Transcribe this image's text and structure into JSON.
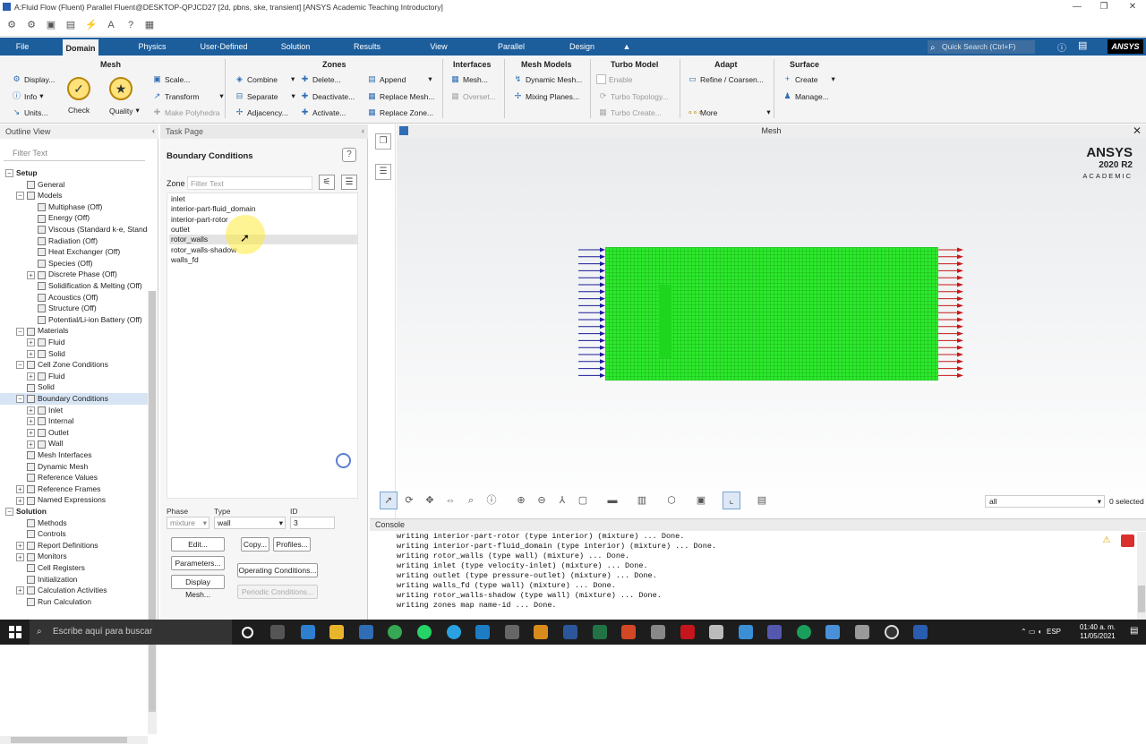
{
  "window": {
    "title": "A:Fluid Flow (Fluent) Parallel Fluent@DESKTOP-QPJCD27  [2d, pbns, ske, transient] [ANSYS Academic Teaching Introductory]",
    "controls": [
      "—",
      "❐",
      "✕"
    ]
  },
  "menu": {
    "tabs": [
      "File",
      "Domain",
      "Physics",
      "User-Defined",
      "Solution",
      "Results",
      "View",
      "Parallel",
      "Design"
    ],
    "active": "Domain",
    "search_placeholder": "Quick Search (Ctrl+F)",
    "logo": "ANSYS"
  },
  "ribbon": {
    "mesh": {
      "title": "Mesh",
      "display": "Display...",
      "info": "Info",
      "units": "Units...",
      "check": "Check",
      "quality": "Quality"
    },
    "scale": "Scale...",
    "transform": "Transform",
    "make_polyhedra": "Make Polyhedra",
    "zones": {
      "title": "Zones",
      "combine": "Combine",
      "separate": "Separate",
      "adjacency": "Adjacency...",
      "delete": "Delete...",
      "deactivate": "Deactivate...",
      "activate": "Activate...",
      "append": "Append",
      "replace_mesh": "Replace Mesh...",
      "replace_zone": "Replace Zone..."
    },
    "interfaces": {
      "title": "Interfaces",
      "mesh": "Mesh...",
      "overset": "Overset..."
    },
    "mesh_models": {
      "title": "Mesh Models",
      "dynamic_mesh": "Dynamic Mesh...",
      "mixing_planes": "Mixing Planes..."
    },
    "turbo": {
      "title": "Turbo Model",
      "enable": "Enable",
      "topology": "Turbo Topology...",
      "create": "Turbo Create..."
    },
    "adapt": {
      "title": "Adapt",
      "refine": "Refine / Coarsen...",
      "more": "More"
    },
    "surface": {
      "title": "Surface",
      "create": "Create",
      "manage": "Manage..."
    }
  },
  "outline": {
    "title": "Outline View",
    "filter_placeholder": "Filter Text",
    "items": [
      {
        "label": "Setup",
        "level": 0,
        "bold": true,
        "toggle": "−"
      },
      {
        "label": "General",
        "level": 2
      },
      {
        "label": "Models",
        "level": 1,
        "toggle": "−"
      },
      {
        "label": "Multiphase (Off)",
        "level": 3
      },
      {
        "label": "Energy (Off)",
        "level": 3
      },
      {
        "label": "Viscous (Standard k-e, Standard Wall Fn)",
        "level": 3
      },
      {
        "label": "Radiation (Off)",
        "level": 3
      },
      {
        "label": "Heat Exchanger (Off)",
        "level": 3
      },
      {
        "label": "Species (Off)",
        "level": 3
      },
      {
        "label": "Discrete Phase (Off)",
        "level": 2,
        "toggle": "+"
      },
      {
        "label": "Solidification & Melting (Off)",
        "level": 3
      },
      {
        "label": "Acoustics (Off)",
        "level": 3
      },
      {
        "label": "Structure (Off)",
        "level": 3
      },
      {
        "label": "Potential/Li-ion Battery (Off)",
        "level": 3
      },
      {
        "label": "Materials",
        "level": 1,
        "toggle": "−"
      },
      {
        "label": "Fluid",
        "level": 2,
        "toggle": "+"
      },
      {
        "label": "Solid",
        "level": 2,
        "toggle": "+"
      },
      {
        "label": "Cell Zone Conditions",
        "level": 1,
        "toggle": "−"
      },
      {
        "label": "Fluid",
        "level": 2,
        "toggle": "+"
      },
      {
        "label": "Solid",
        "level": 2
      },
      {
        "label": "Boundary Conditions",
        "level": 1,
        "toggle": "−",
        "selected": true
      },
      {
        "label": "Inlet",
        "level": 2,
        "toggle": "+"
      },
      {
        "label": "Internal",
        "level": 2,
        "toggle": "+"
      },
      {
        "label": "Outlet",
        "level": 2,
        "toggle": "+"
      },
      {
        "label": "Wall",
        "level": 2,
        "toggle": "+"
      },
      {
        "label": "Mesh Interfaces",
        "level": 2
      },
      {
        "label": "Dynamic Mesh",
        "level": 2
      },
      {
        "label": "Reference Values",
        "level": 2
      },
      {
        "label": "Reference Frames",
        "level": 1,
        "toggle": "+"
      },
      {
        "label": "Named Expressions",
        "level": 1,
        "toggle": "+"
      },
      {
        "label": "Solution",
        "level": 0,
        "bold": true,
        "toggle": "−"
      },
      {
        "label": "Methods",
        "level": 2
      },
      {
        "label": "Controls",
        "level": 2
      },
      {
        "label": "Report Definitions",
        "level": 1,
        "toggle": "+"
      },
      {
        "label": "Monitors",
        "level": 1,
        "toggle": "+"
      },
      {
        "label": "Cell Registers",
        "level": 2
      },
      {
        "label": "Initialization",
        "level": 2
      },
      {
        "label": "Calculation Activities",
        "level": 1,
        "toggle": "+"
      },
      {
        "label": "Run Calculation",
        "level": 2
      }
    ]
  },
  "task": {
    "title": "Task Page",
    "panel_title": "Boundary Conditions",
    "zone_label": "Zone",
    "zone_filter_placeholder": "Filter Text",
    "zones": [
      "inlet",
      "interior-part-fluid_domain",
      "interior-part-rotor",
      "outlet",
      "rotor_walls",
      "rotor_walls-shadow",
      "walls_fd"
    ],
    "selected_zone": "rotor_walls",
    "phase_label": "Phase",
    "phase_value": "mixture",
    "type_label": "Type",
    "type_value": "wall",
    "id_label": "ID",
    "id_value": "3",
    "buttons": {
      "edit": "Edit...",
      "copy": "Copy...",
      "profiles": "Profiles...",
      "parameters": "Parameters...",
      "operating": "Operating Conditions...",
      "display_mesh": "Display Mesh...",
      "periodic": "Periodic Conditions..."
    }
  },
  "graphics": {
    "title": "Mesh",
    "logo_line1": "ANSYS",
    "logo_line2": "2020 R2",
    "logo_line3": "ACADEMIC",
    "select_value": "all",
    "selected_count": "0 selected"
  },
  "console": {
    "title": "Console",
    "lines": [
      "writing interior-part-rotor (type interior) (mixture) ... Done.",
      "writing interior-part-fluid_domain (type interior) (mixture) ... Done.",
      "writing rotor_walls (type wall) (mixture) ... Done.",
      "writing inlet (type velocity-inlet) (mixture) ... Done.",
      "writing outlet (type pressure-outlet) (mixture) ... Done.",
      "writing walls_fd (type wall) (mixture) ... Done.",
      "writing rotor_walls-shadow (type wall) (mixture) ... Done.",
      "writing zones map name-id ... Done."
    ]
  },
  "taskbar": {
    "search_placeholder": "Escribe aquí para buscar",
    "lang": "ESP",
    "time": "01:40 a. m.",
    "date": "11/05/2021"
  },
  "colors": {
    "accent": "#1c5d9c",
    "mesh": "#2ce82c",
    "inlet_arrow": "#1a1a9a",
    "outlet_arrow": "#c81818"
  }
}
